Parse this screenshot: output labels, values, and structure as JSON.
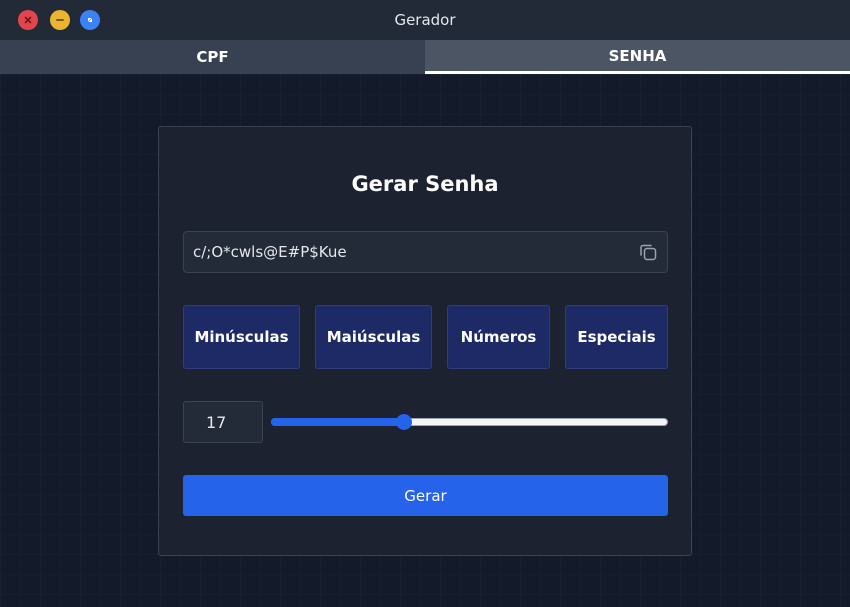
{
  "window": {
    "title": "Gerador",
    "controls": [
      "close-icon",
      "minimize-icon",
      "maximize-icon"
    ]
  },
  "tabs": [
    {
      "label": "CPF",
      "active": false
    },
    {
      "label": "SENHA",
      "active": true
    }
  ],
  "card": {
    "title": "Gerar Senha",
    "password": {
      "value": "c/;O*cwls@E#P$Kue",
      "copy_icon": "copy-icon"
    },
    "options": [
      {
        "label": "Minúsculas"
      },
      {
        "label": "Maiúsculas"
      },
      {
        "label": "Números"
      },
      {
        "label": "Especiais"
      }
    ],
    "length": {
      "value": "17",
      "slider_fraction": 0.335
    },
    "generate_label": "Gerar"
  },
  "colors": {
    "accent": "#2563eb",
    "option_bg": "#1e2a66",
    "card_bg": "#1c2230",
    "close": "#e0474c",
    "minimize": "#ebb52f",
    "maximize": "#3b82f6"
  }
}
